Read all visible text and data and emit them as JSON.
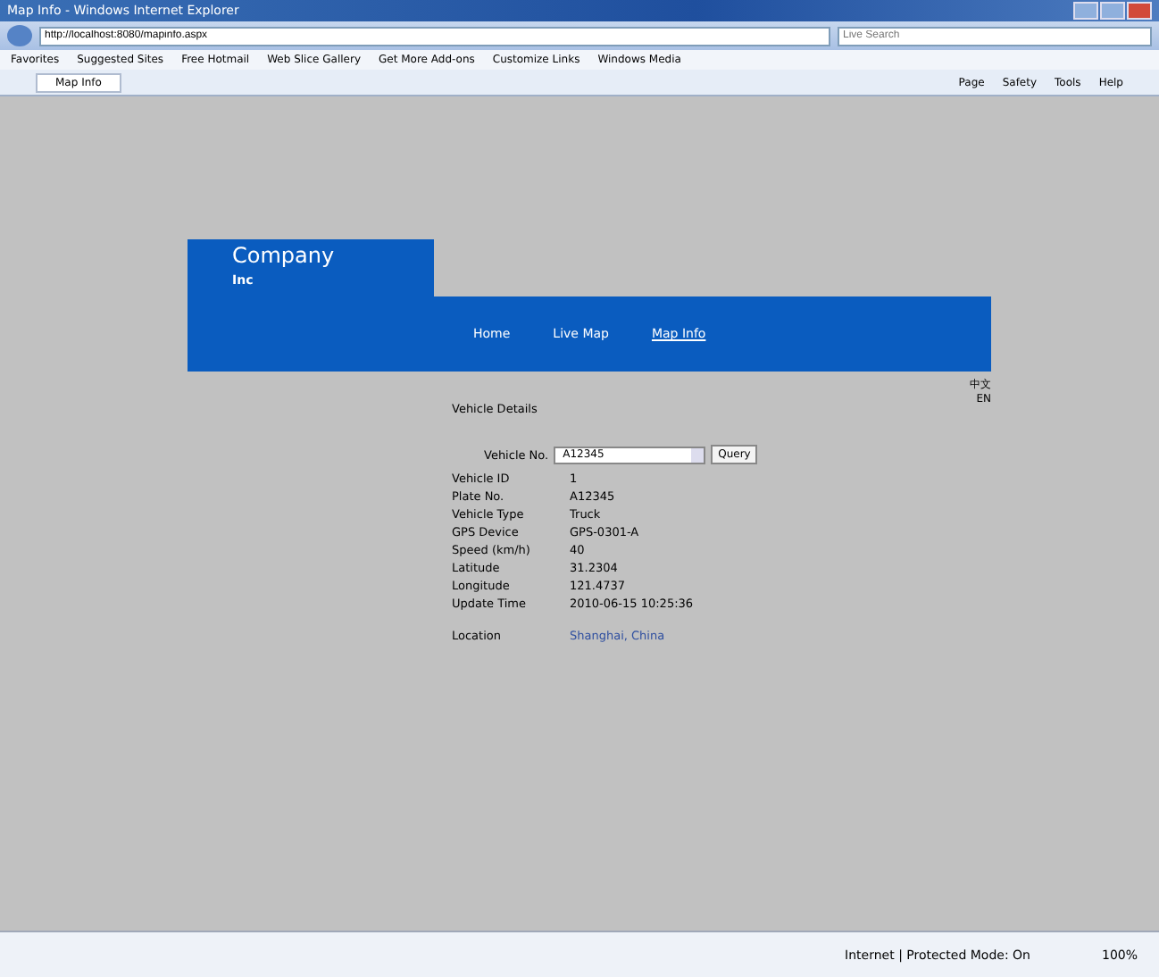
{
  "window": {
    "title": "Map Info - Windows Internet Explorer"
  },
  "address_bar": {
    "url": "http://localhost:8080/mapinfo.aspx",
    "search_placeholder": "Live Search"
  },
  "favorites": [
    "Favorites",
    "Suggested Sites",
    "Free Hotmail",
    "Web Slice Gallery",
    "Get More Add-ons",
    "Customize Links",
    "Windows Media"
  ],
  "tabs": [
    {
      "label": "Map Info",
      "selected": true
    }
  ],
  "command_bar": [
    "Page",
    "Safety",
    "Tools",
    "Help"
  ],
  "site": {
    "logo": "Company",
    "logo_sub": "Inc",
    "nav": [
      {
        "label": "Home",
        "selected": false
      },
      {
        "label": "Live Map",
        "selected": false
      },
      {
        "label": "Map Info",
        "selected": true
      }
    ],
    "languages": [
      "中文",
      "EN"
    ]
  },
  "form": {
    "title": "Vehicle Details",
    "select_label": "Vehicle No.",
    "select_value": "A12345",
    "button": "Query",
    "fields": [
      {
        "label": "Vehicle ID",
        "value": "1"
      },
      {
        "label": "Plate No.",
        "value": "A12345"
      },
      {
        "label": "Vehicle Type",
        "value": "Truck"
      },
      {
        "label": "GPS Device",
        "value": "GPS-0301-A"
      },
      {
        "label": "Speed (km/h)",
        "value": "40"
      },
      {
        "label": "Latitude",
        "value": "31.2304"
      },
      {
        "label": "Longitude",
        "value": "121.4737"
      },
      {
        "label": "Update Time",
        "value": "2010-06-15 10:25:36"
      },
      {
        "label": "Location",
        "value": "Shanghai, China",
        "kind": "link"
      }
    ]
  },
  "status_bar": {
    "zone": "Internet | Protected Mode: On",
    "zoom": "100%"
  }
}
